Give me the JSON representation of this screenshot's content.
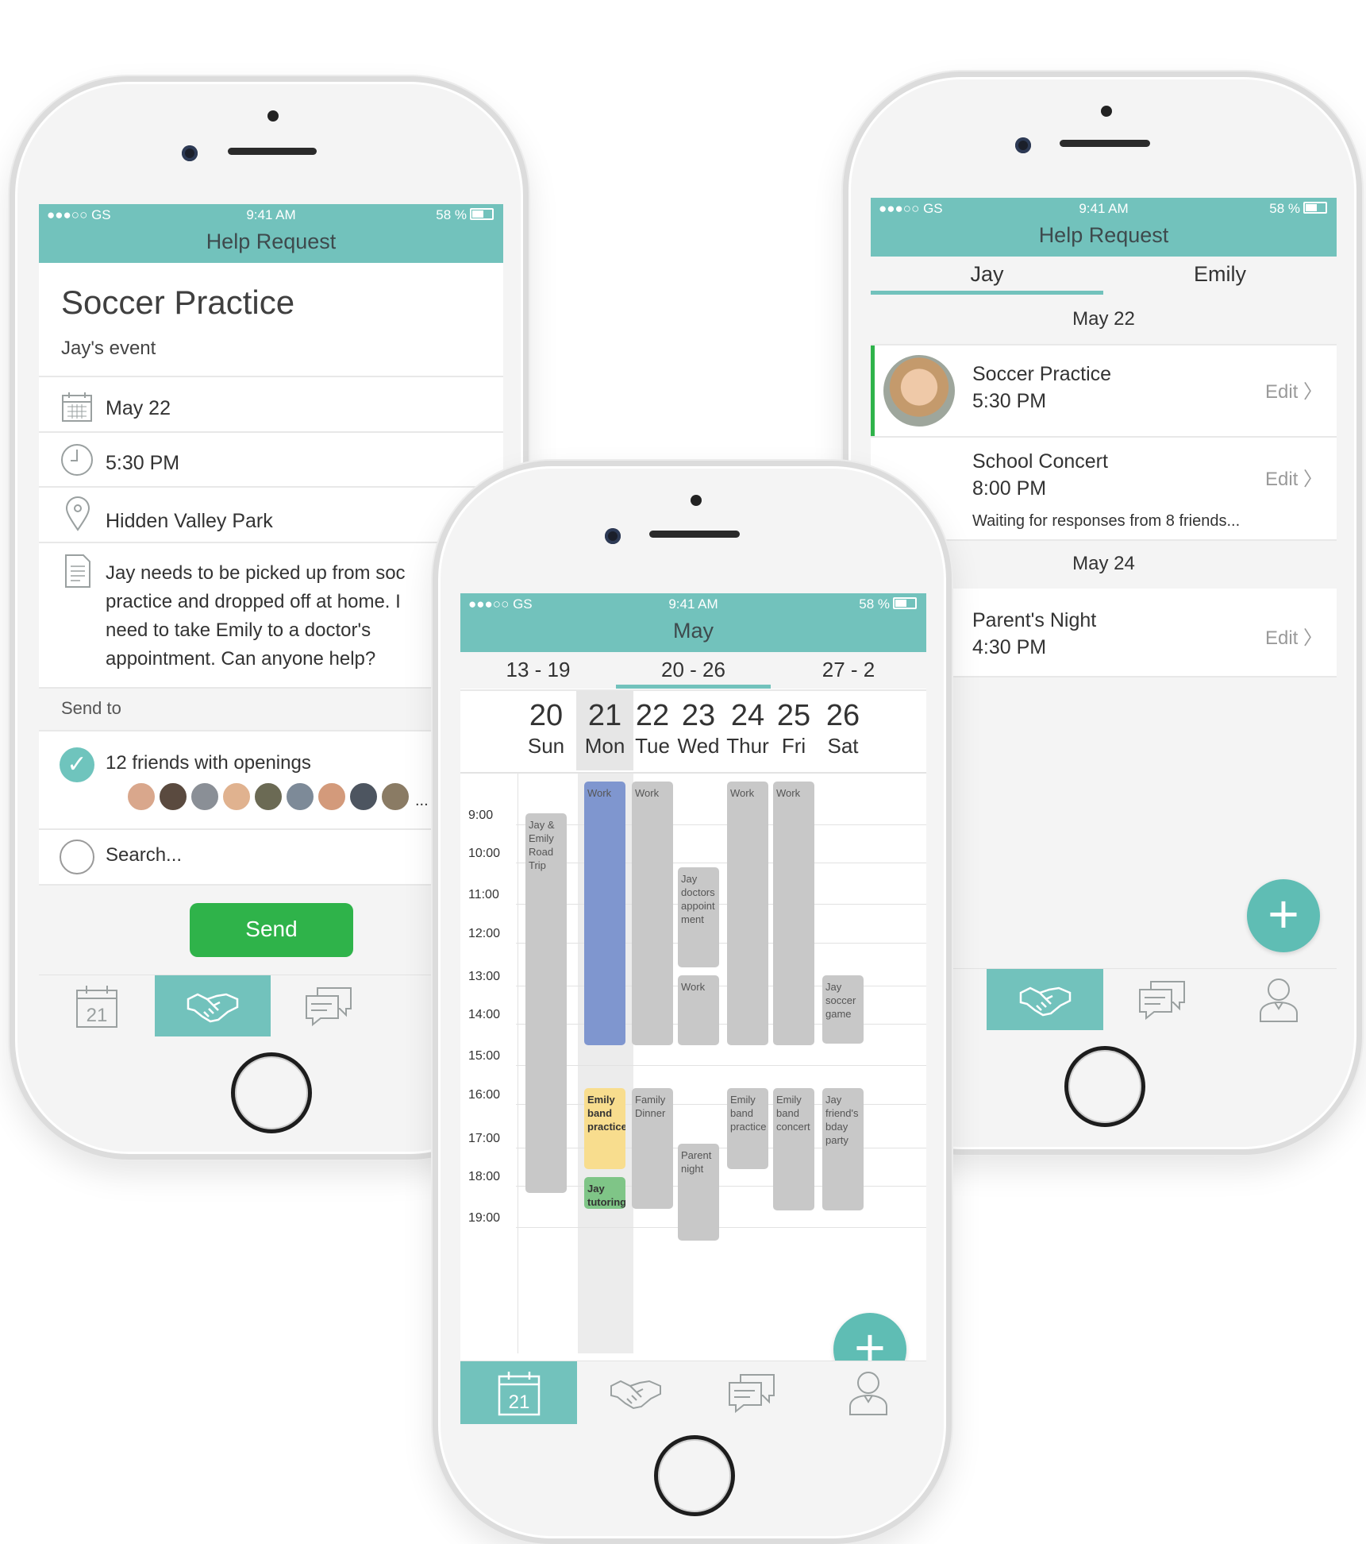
{
  "left_phone": {
    "status": {
      "carrier": "●●●○○ GS",
      "time": "9:41 AM",
      "battery": "58 %"
    },
    "header_title": "Help Request",
    "event_title": "Soccer Practice",
    "event_owner": "Jay's event",
    "date": "May 22",
    "time": "5:30 PM",
    "location": "Hidden Valley Park",
    "description_lines": [
      "Jay needs to be picked up from soc",
      "practice and dropped off at home. I",
      "need to take Emily to a doctor's",
      "appointment. Can anyone help?"
    ],
    "send_to_label": "Send to",
    "friends_option": "12 friends with openings",
    "more_marker": "...",
    "search_placeholder": "Search...",
    "send_button": "Send",
    "tab_calendar_day": "21"
  },
  "center_phone": {
    "status": {
      "carrier": "●●●○○ GS",
      "time": "9:41 AM",
      "battery": "58 %"
    },
    "header_title": "May",
    "week_ranges": [
      "13 - 19",
      "20 - 26",
      "27 - 2"
    ],
    "selected_week_index": 1,
    "days": [
      {
        "num": "20",
        "name": "Sun"
      },
      {
        "num": "21",
        "name": "Mon"
      },
      {
        "num": "22",
        "name": "Tue"
      },
      {
        "num": "23",
        "name": "Wed"
      },
      {
        "num": "24",
        "name": "Thur"
      },
      {
        "num": "25",
        "name": "Fri"
      },
      {
        "num": "26",
        "name": "Sat"
      }
    ],
    "hours": [
      "9:00",
      "10:00",
      "11:00",
      "12:00",
      "13:00",
      "14:00",
      "15:00",
      "16:00",
      "17:00",
      "18:00",
      "19:00"
    ],
    "events": {
      "sun_trip": "Jay & Emily Road Trip",
      "mon_work": "Work",
      "tue_work": "Work",
      "wed_doctor": "Jay doctors appoint ment",
      "wed_work": "Work",
      "thu_work": "Work",
      "fri_work": "Work",
      "sat_soccer": "Jay soccer game",
      "mon_band": "Emily band practice",
      "mon_tutoring": "Jay tutoring",
      "tue_dinner": "Family Dinner",
      "wed_parent": "Parent night",
      "thu_band": "Emily band practice",
      "fri_concert": "Emily band concert",
      "sat_party": "Jay friend's bday party"
    },
    "fab": "+",
    "tab_calendar_day": "21"
  },
  "right_phone": {
    "status": {
      "carrier": "●●●○○ GS",
      "time": "9:41 AM",
      "battery": "58 %"
    },
    "header_title": "Help Request",
    "tabs": [
      "Jay",
      "Emily"
    ],
    "section1": "May 22",
    "items": [
      {
        "title": "Soccer Practice",
        "time": "5:30 PM",
        "action": "Edit"
      },
      {
        "title": "School Concert",
        "time": "8:00 PM",
        "action": "Edit"
      }
    ],
    "waiting_text": "Waiting for responses from 8 friends...",
    "section2": "May 24",
    "item3": {
      "title": "Parent's Night",
      "time": "4:30 PM",
      "action": "Edit"
    },
    "fab": "+"
  },
  "colors": {
    "accent": "#72c2bc",
    "send_green": "#2fb34a",
    "event_gray": "#c8c8c8",
    "event_blue": "#7f96cf",
    "event_yellow": "#f8dd8e",
    "event_green": "#7fc587"
  }
}
